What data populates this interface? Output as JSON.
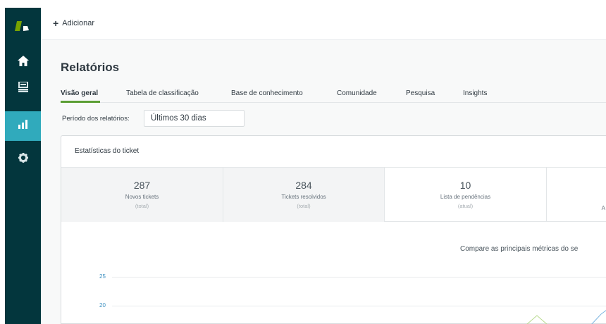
{
  "sidebar": {
    "logo_icon": "zendesk-logo-icon",
    "items": [
      {
        "icon": "home-icon"
      },
      {
        "icon": "views-icon"
      },
      {
        "icon": "reports-icon",
        "active": true
      },
      {
        "icon": "gear-icon"
      }
    ],
    "accent": "#30aabc"
  },
  "topbar": {
    "add_label": "Adicionar"
  },
  "page": {
    "title": "Relatórios"
  },
  "tabs": [
    {
      "label": "Visão geral",
      "active": true
    },
    {
      "label": "Tabela de classificação"
    },
    {
      "label": "Base de conhecimento"
    },
    {
      "label": "Comunidade"
    },
    {
      "label": "Pesquisa"
    },
    {
      "label": "Insights"
    }
  ],
  "period": {
    "label": "Período dos relatórios:",
    "selected": "Últimos 30 dias"
  },
  "ticket_stats": {
    "title": "Estatísticas do ticket",
    "stats": [
      {
        "value": "287",
        "label": "Novos tickets",
        "sub": "(total)"
      },
      {
        "value": "284",
        "label": "Tickets resolvidos",
        "sub": "(total)"
      },
      {
        "value": "10",
        "label": "Lista de pendências",
        "sub": "(atual)"
      },
      {
        "value": "",
        "label": "A",
        "sub": ""
      }
    ],
    "compare_text": "Compare as principais métricas do se",
    "y_ticks": [
      "25",
      "20"
    ]
  },
  "colors": {
    "tab_underline": "#5b9e34",
    "series_green": "#b6d98c",
    "series_blue": "#7fb6e0"
  }
}
